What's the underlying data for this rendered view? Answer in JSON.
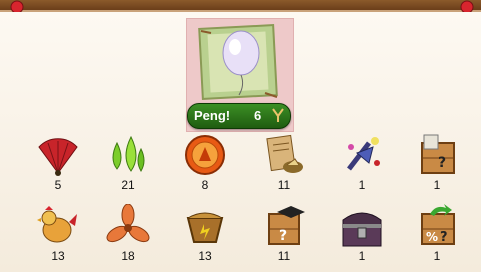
{
  "featured": {
    "name": "Peng!",
    "count": "6",
    "icon": "balloon-icon"
  },
  "row1": [
    {
      "icon": "fan-icon",
      "count": "5"
    },
    {
      "icon": "green-drops-icon",
      "count": "21"
    },
    {
      "icon": "medal-icon",
      "count": "8"
    },
    {
      "icon": "recipe-scroll-icon",
      "count": "11"
    },
    {
      "icon": "sparkle-wand-icon",
      "count": "1"
    },
    {
      "icon": "mystery-crate-icon",
      "count": "1"
    }
  ],
  "row2": [
    {
      "icon": "rooster-icon",
      "count": "13"
    },
    {
      "icon": "propeller-icon",
      "count": "18"
    },
    {
      "icon": "nest-icon",
      "count": "13"
    },
    {
      "icon": "graduation-crate-icon",
      "count": "11"
    },
    {
      "icon": "treasure-chest-icon",
      "count": "1"
    },
    {
      "icon": "discount-crate-icon",
      "count": "1"
    }
  ]
}
